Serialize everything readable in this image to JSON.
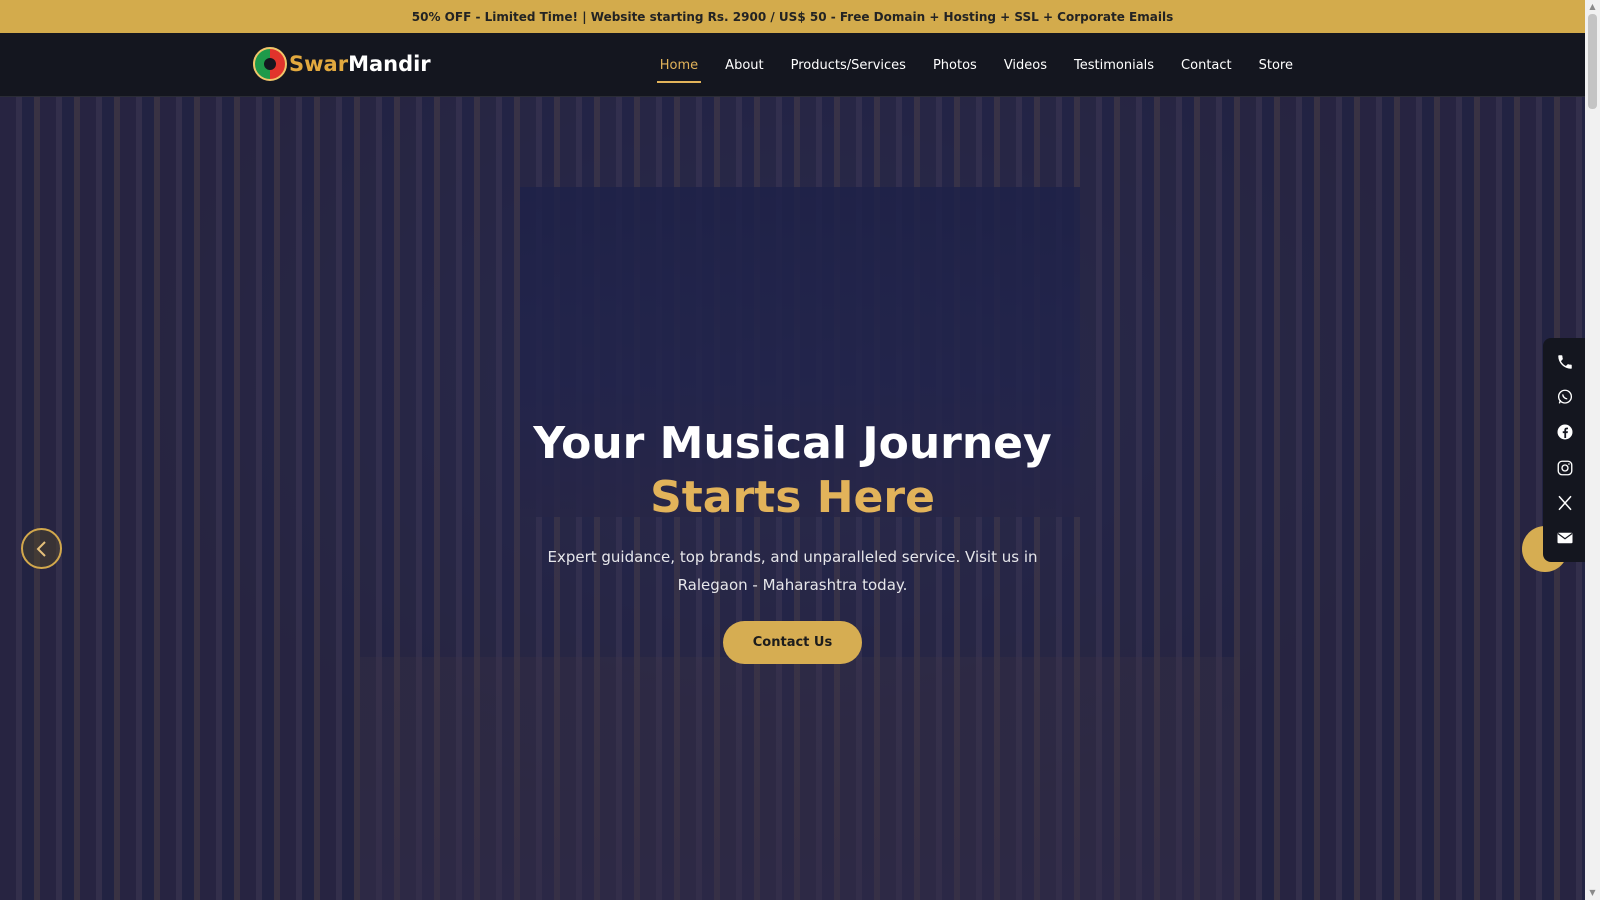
{
  "promo": {
    "text": "50% OFF - Limited Time! | Website starting Rs. 2900 / US$ 50 - Free Domain + Hosting + SSL + Corporate Emails"
  },
  "header": {
    "logo_part1": "Swar",
    "logo_part2": "Mandir",
    "nav": [
      {
        "label": "Home",
        "active": true
      },
      {
        "label": "About"
      },
      {
        "label": "Products/Services"
      },
      {
        "label": "Photos"
      },
      {
        "label": "Videos"
      },
      {
        "label": "Testimonials"
      },
      {
        "label": "Contact"
      },
      {
        "label": "Store"
      }
    ]
  },
  "hero": {
    "title_line1": "Your Musical Journey",
    "title_line2": "Starts Here",
    "subtitle": "Expert guidance, top brands, and unparalleled service. Visit us in Ralegaon - Maharashtra today.",
    "cta": "Contact Us"
  },
  "slider": {
    "prev_icon": "chevron-left-icon",
    "next_icon": "chevron-right-icon"
  },
  "social": [
    "phone-icon",
    "whatsapp-icon",
    "facebook-icon",
    "instagram-icon",
    "x-icon",
    "email-icon"
  ],
  "colors": {
    "promo_bg": "#d3ab4c",
    "nav_bg": "#14161f",
    "accent": "#e2b35a",
    "cta_bg": "#d6ad52"
  }
}
